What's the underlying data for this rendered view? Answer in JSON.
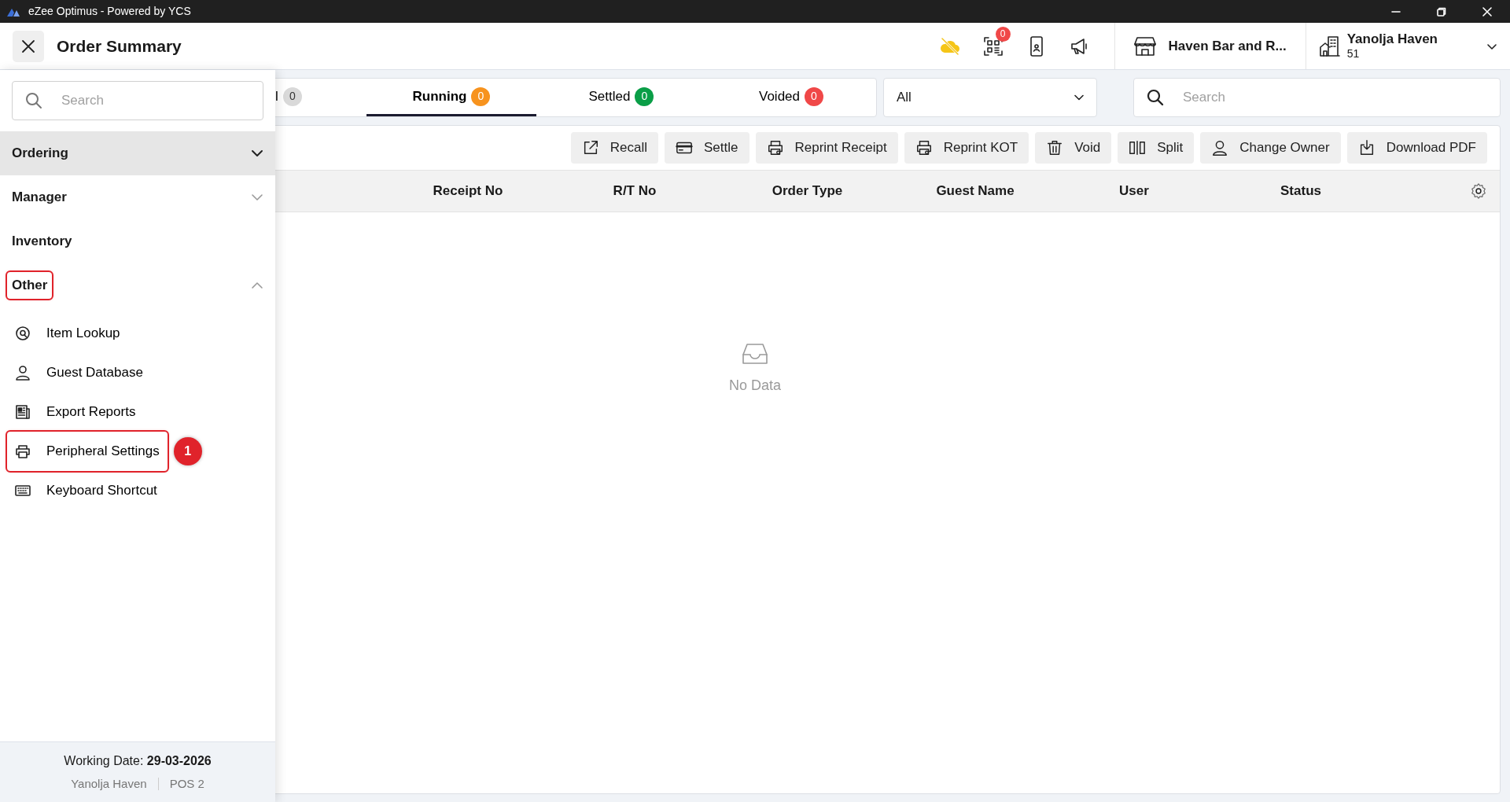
{
  "window": {
    "title": "eZee Optimus - Powered by YCS"
  },
  "header": {
    "title": "Order Summary",
    "notification_count": "0",
    "outlet": "Haven Bar and R...",
    "property": {
      "name": "Yanolja Haven",
      "code": "51"
    }
  },
  "sidebar": {
    "search": {
      "placeholder": "Search"
    },
    "groups": [
      {
        "label": "Ordering",
        "selected": true,
        "expandable": true,
        "expanded": false,
        "highlighted": false
      },
      {
        "label": "Manager",
        "selected": false,
        "expandable": true,
        "expanded": false,
        "highlighted": false
      },
      {
        "label": "Inventory",
        "selected": false,
        "expandable": false,
        "highlighted": false
      },
      {
        "label": "Other",
        "selected": false,
        "expandable": true,
        "expanded": true,
        "highlighted": true,
        "children": [
          {
            "label": "Item Lookup",
            "highlighted": false
          },
          {
            "label": "Guest Database",
            "highlighted": false
          },
          {
            "label": "Export Reports",
            "highlighted": false
          },
          {
            "label": "Peripheral Settings",
            "highlighted": true,
            "annotation": "1"
          },
          {
            "label": "Keyboard Shortcut",
            "highlighted": false
          }
        ]
      }
    ],
    "footer": {
      "working_date": "Working Date: **29-03-2026**",
      "outlet": "Yanolja Haven",
      "terminal": "POS 2"
    }
  },
  "tabs": [
    {
      "label": "l",
      "count": "0",
      "color": "#d9d9d9",
      "selected": false
    },
    {
      "label": "Running",
      "count": "0",
      "color": "#f7931e",
      "selected": true
    },
    {
      "label": "Settled",
      "count": "0",
      "color": "#0a9e47",
      "selected": false
    },
    {
      "label": "Voided",
      "count": "0",
      "color": "#f04848",
      "selected": false
    }
  ],
  "filter": {
    "value": "All"
  },
  "search": {
    "placeholder": "Search"
  },
  "actions": [
    "Recall",
    "Settle",
    "Reprint Receipt",
    "Reprint KOT",
    "Void",
    "Split",
    "Change Owner",
    "Download PDF"
  ],
  "table": {
    "columns": [
      "Receipt No",
      "R/T No",
      "Order Type",
      "Guest Name",
      "User",
      "Status"
    ],
    "empty_text": "No Data"
  }
}
